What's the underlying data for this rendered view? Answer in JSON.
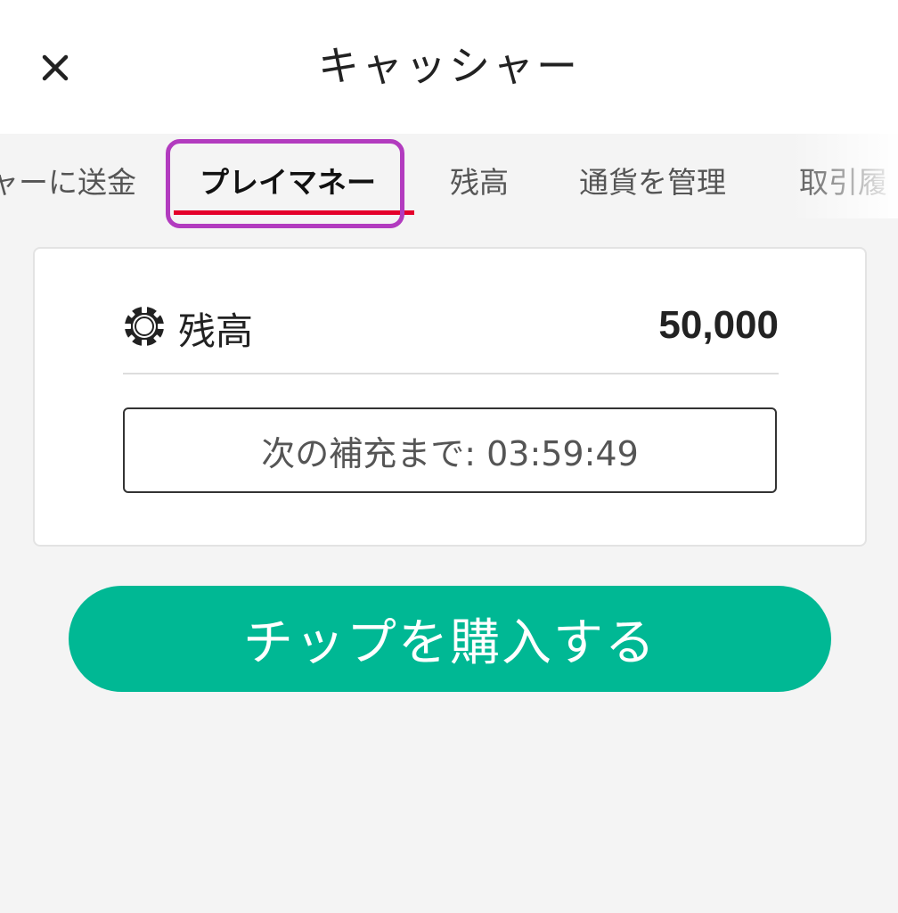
{
  "header": {
    "title": "キャッシャー",
    "close_icon": "close-icon"
  },
  "tabs": [
    {
      "label": "ャーに送金",
      "active": false
    },
    {
      "label": "プレイマネー",
      "active": true
    },
    {
      "label": "残高",
      "active": false
    },
    {
      "label": "通貨を管理",
      "active": false
    },
    {
      "label": "取引履",
      "active": false
    }
  ],
  "balance": {
    "icon": "poker-chip-icon",
    "label": "残高",
    "value": "50,000"
  },
  "refill": {
    "text": "次の補充まで: 03:59:49"
  },
  "buy_button": {
    "label": "チップを購入する"
  },
  "colors": {
    "accent_green": "#00b894",
    "tab_underline_red": "#e4002b",
    "highlight_purple": "#b23bbf"
  }
}
